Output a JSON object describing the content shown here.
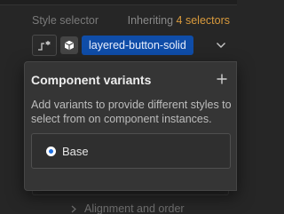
{
  "style_selector": {
    "label": "Style selector",
    "inheriting_prefix": "Inheriting",
    "inheriting_count": "4 selectors",
    "class_name": "layered-button-solid"
  },
  "popover": {
    "title": "Component variants",
    "description": "Add variants to provide different styles to select from on component instances.",
    "variants": [
      {
        "label": "Base",
        "selected": true
      }
    ]
  },
  "section": {
    "label": "Alignment and order"
  },
  "colors": {
    "accent": "#0f4da8",
    "inheriting_count": "#d99a3c",
    "radio_dot": "#1e6fe0"
  }
}
